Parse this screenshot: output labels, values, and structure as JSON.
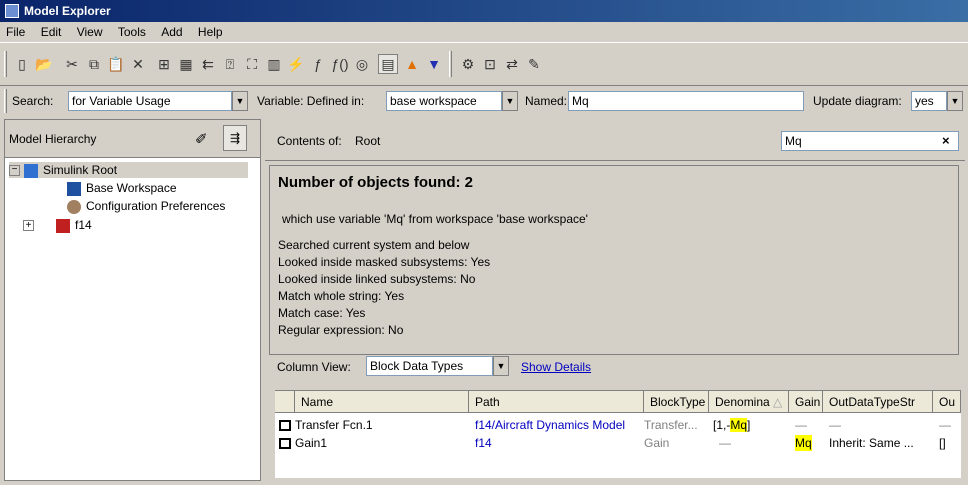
{
  "window": {
    "title": "Model Explorer"
  },
  "menu": [
    "File",
    "Edit",
    "View",
    "Tools",
    "Add",
    "Help"
  ],
  "searchbar": {
    "search_label": "Search:",
    "search_value": "for Variable Usage",
    "variable_label": "Variable: Defined in:",
    "variable_value": "base workspace",
    "named_label": "Named:",
    "named_value": "Mq",
    "update_label": "Update diagram:",
    "update_value": "yes"
  },
  "tree": {
    "header": "Model Hierarchy",
    "root": "Simulink Root",
    "items": [
      "Base Workspace",
      "Configuration Preferences",
      "f14"
    ]
  },
  "contents": {
    "label": "Contents of:",
    "value": "Root",
    "filter_value": "Mq"
  },
  "results": {
    "count_text": "Number of objects found: 2",
    "uses_text": "which use variable 'Mq' from workspace 'base workspace'",
    "lines": [
      "Searched current system and below",
      "Looked inside masked subsystems:  Yes",
      "Looked inside linked subsystems:  No",
      "Match whole string:  Yes",
      "Match case:  Yes",
      "Regular expression:  No"
    ]
  },
  "column_view": {
    "label": "Column View:",
    "value": "Block Data Types",
    "details_link": "Show Details"
  },
  "table": {
    "headers": [
      "Name",
      "Path",
      "BlockType",
      "Denomina",
      "Gain",
      "OutDataTypeStr",
      "Ou"
    ],
    "rows": [
      {
        "name": "Transfer Fcn.1",
        "path": "f14/Aircraft Dynamics Model",
        "blocktype": "Transfer...",
        "denom_prefix": "[1,-",
        "denom_var": "Mq",
        "denom_suffix": "]",
        "gain": "—",
        "outtype": "—",
        "ou": "—"
      },
      {
        "name": "Gain1",
        "path": "f14",
        "blocktype": "Gain",
        "denom_prefix": "—",
        "denom_var": "",
        "denom_suffix": "",
        "gain": "Mq",
        "outtype": "Inherit: Same ...",
        "ou": "[]"
      }
    ]
  },
  "colors": {
    "title_start": "#0a246a",
    "title_end": "#3a6ea5",
    "link": "#0000c0",
    "highlight": "#ffff00"
  }
}
